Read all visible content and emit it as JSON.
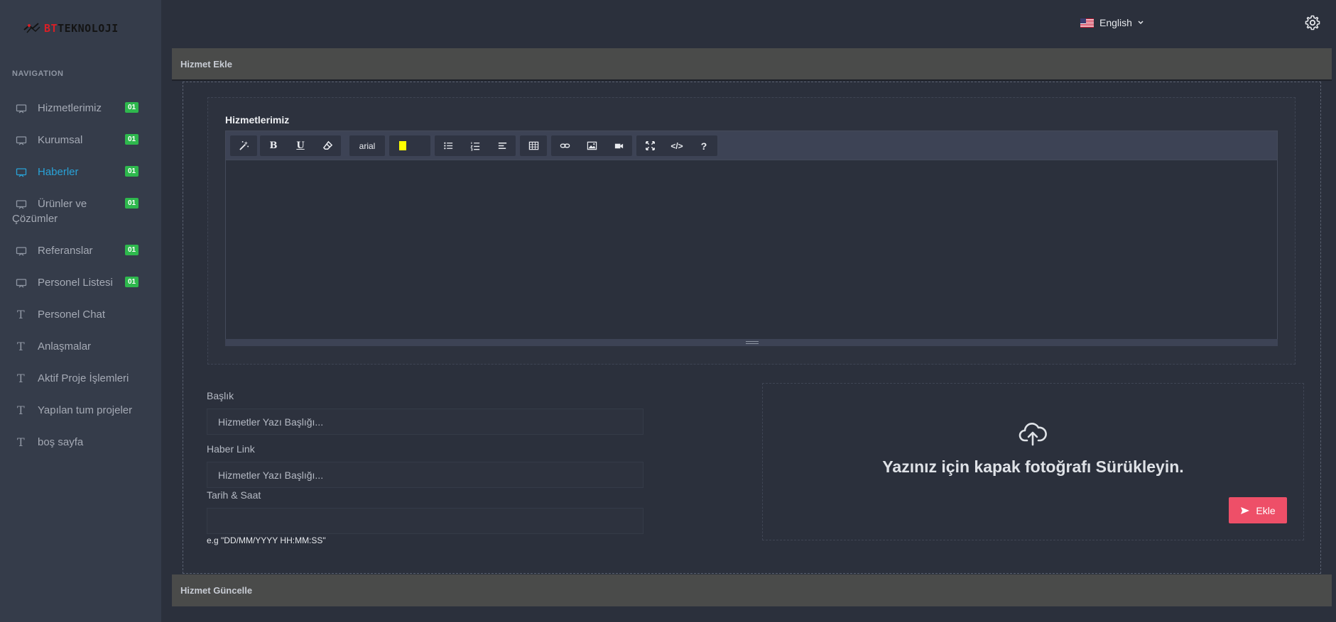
{
  "brand": {
    "prefix": "BT",
    "name": "TEKNOLOJI"
  },
  "sidebar": {
    "heading": "NAVIGATION",
    "items": [
      {
        "label": "Hizmetlerimiz",
        "badge": "01",
        "icon": "monitor-icon"
      },
      {
        "label": "Kurumsal",
        "badge": "01",
        "icon": "monitor-icon"
      },
      {
        "label": "Haberler",
        "badge": "01",
        "icon": "monitor-icon",
        "active": true
      },
      {
        "label_line1": "Ürünler ve",
        "label_line2": "Çözümler",
        "badge": "01",
        "icon": "monitor-icon"
      },
      {
        "label": "Referanslar",
        "badge": "01",
        "icon": "monitor-icon"
      },
      {
        "label": "Personel Listesi",
        "badge": "01",
        "icon": "monitor-icon"
      },
      {
        "label": "Personel Chat",
        "icon": "text-icon"
      },
      {
        "label": "Anlaşmalar",
        "icon": "text-icon"
      },
      {
        "label": "Aktif Proje İşlemleri",
        "icon": "text-icon"
      },
      {
        "label": "Yapılan tum projeler",
        "icon": "text-icon"
      },
      {
        "label": "boş sayfa",
        "icon": "text-icon"
      }
    ]
  },
  "topbar": {
    "language": "English",
    "flag_icon": "us-flag-icon",
    "settings_icon": "gear-icon"
  },
  "panels": {
    "add_title": "Hizmet Ekle",
    "update_title": "Hizmet Güncelle"
  },
  "editor": {
    "title": "Hizmetlerimiz",
    "font_name": "arial",
    "toolbar_icons": [
      "magic-icon",
      "bold-icon",
      "underline-icon",
      "eraser-icon",
      "font-family-select",
      "highlight-color-icon",
      "unordered-list-icon",
      "ordered-list-icon",
      "align-icon",
      "table-icon",
      "link-icon",
      "image-icon",
      "video-icon",
      "fullscreen-icon",
      "code-view-icon",
      "help-icon"
    ],
    "bold_glyph": "B",
    "underline_glyph": "U",
    "help_glyph": "?",
    "code_glyph": "</>"
  },
  "form": {
    "title_label": "Başlık",
    "title_placeholder": "Hizmetler Yazı Başlığı...",
    "link_label": "Haber Link",
    "link_placeholder": "Hizmetler Yazı Başlığı...",
    "datetime_label": "Tarih & Saat",
    "datetime_hint": "e.g \"DD/MM/YYYY HH:MM:SS\""
  },
  "dropzone": {
    "text": "Yazınız için kapak fotoğrafı Sürükleyin.",
    "icon": "cloud-upload-icon"
  },
  "submit": {
    "label": "Ekle",
    "icon": "send-icon",
    "color": "#ee4f68"
  },
  "colors": {
    "badge": "#2eb84d",
    "active": "#29a3d8",
    "highlight": "#ffff00"
  }
}
